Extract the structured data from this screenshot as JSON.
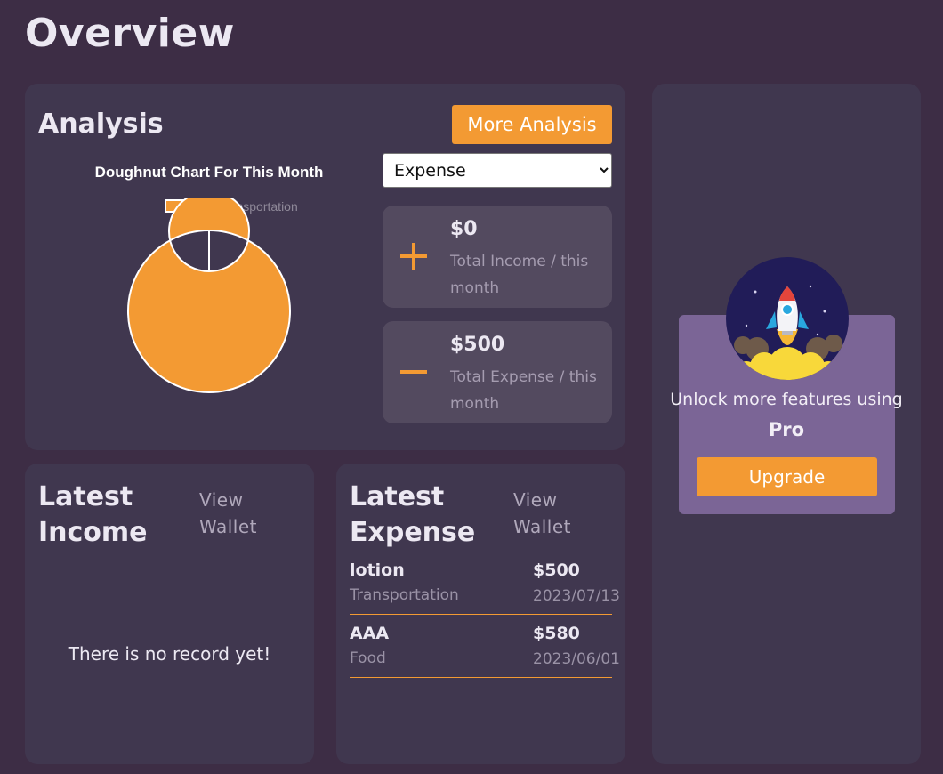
{
  "page": {
    "title": "Overview"
  },
  "analysis": {
    "title": "Analysis",
    "more_button": "More Analysis",
    "select": {
      "selected": "Expense",
      "options": [
        "Expense"
      ]
    },
    "income_stat": {
      "value": "$0",
      "label": "Total Income / this month"
    },
    "expense_stat": {
      "value": "$500",
      "label": "Total Expense / this month"
    }
  },
  "chart_data": {
    "type": "pie",
    "title": "Doughnut Chart For This Month",
    "categories": [
      "Transportation"
    ],
    "values": [
      500
    ],
    "colors": [
      "#f39a33"
    ],
    "legend": "top"
  },
  "latest_income": {
    "title": "Latest Income",
    "view_wallet": "View Wallet",
    "empty_text": "There is no record yet!"
  },
  "latest_expense": {
    "title": "Latest Expense",
    "view_wallet": "View Wallet",
    "items": [
      {
        "name": "lotion",
        "category": "Transportation",
        "amount": "$500",
        "date": "2023/07/13"
      },
      {
        "name": "AAA",
        "category": "Food",
        "amount": "$580",
        "date": "2023/06/01"
      }
    ]
  },
  "promo": {
    "text_prefix": "Unlock more features using",
    "text_bold": "Pro",
    "button": "Upgrade",
    "icon": "rocket-icon"
  },
  "colors": {
    "accent": "#f39a33",
    "background": "#3d2d45",
    "card": "#40374f",
    "promo": "#7b6596"
  }
}
